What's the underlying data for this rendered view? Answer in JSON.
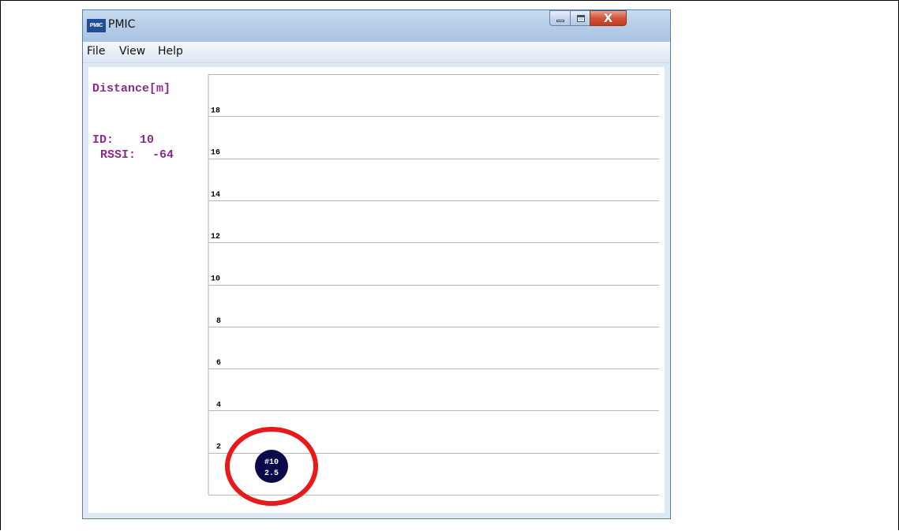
{
  "window": {
    "title": "PMIC",
    "logo_text": "PMIC",
    "close_glyph": "X"
  },
  "menu": {
    "items": [
      "File",
      "View",
      "Help"
    ]
  },
  "info": {
    "distance_label": "Distance[m]",
    "id_label": "ID:",
    "id_value": "10",
    "rssi_label": "RSSI:",
    "rssi_value": "-64"
  },
  "chart_data": {
    "type": "scatter",
    "y_ticks": [
      "18",
      "16",
      "14",
      "12",
      "10",
      "8",
      "6",
      "4",
      "2"
    ],
    "ylim": [
      0,
      20
    ],
    "grid": true,
    "points": [
      {
        "id_label": "#10",
        "value_label": "2.5",
        "y": 1.5
      }
    ],
    "marker_color": "#0a0a4a",
    "highlight_color": "#e8191b"
  }
}
